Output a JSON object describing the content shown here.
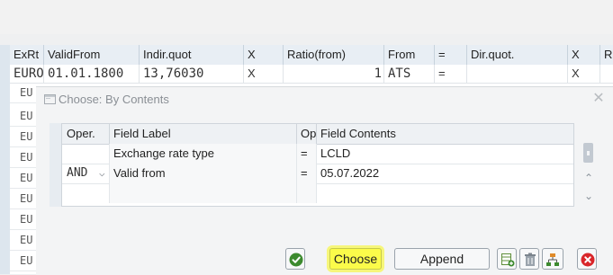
{
  "background_table": {
    "headers": [
      "ExRt",
      "ValidFrom",
      "Indir.quot",
      "X",
      "Ratio(from)",
      "From",
      "=",
      "Dir.quot.",
      "X",
      "Ra"
    ],
    "first_row": [
      "EURO",
      "01.01.1800",
      "13,76030",
      "X",
      "1",
      "ATS",
      "=",
      "",
      "X",
      ""
    ],
    "left_rows": [
      "EU",
      "EU",
      "EU",
      "EU",
      "EU",
      "EU",
      "EU",
      "EU",
      "EU",
      "EU"
    ]
  },
  "dialog": {
    "title": "Choose: By Contents",
    "close_icon": "close-icon",
    "columns": [
      "Oper.",
      "Field Label",
      "Op",
      "Field Contents"
    ],
    "rows": [
      {
        "oper": "",
        "label": "Exchange rate type",
        "op": "=",
        "contents": "LCLD"
      },
      {
        "oper": "AND",
        "label": "Valid from",
        "op": "=",
        "contents": "05.07.2022"
      },
      {
        "oper": "",
        "label": "",
        "op": "",
        "contents": ""
      }
    ],
    "oper_dropdown_icon": "chevron-down-icon",
    "buttons": {
      "choose": "Choose",
      "append": "Append"
    },
    "highlight_color": "#fbfb4a"
  }
}
